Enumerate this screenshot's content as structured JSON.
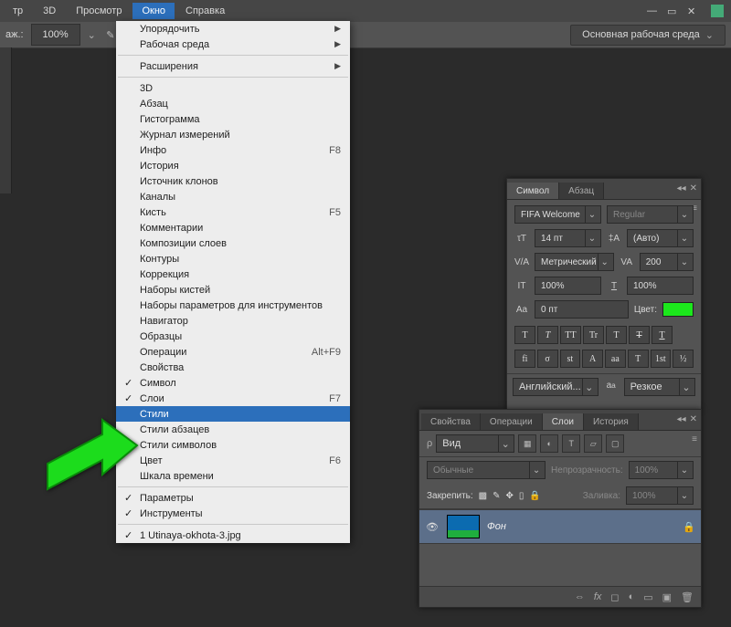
{
  "menubar": {
    "items": [
      "тр",
      "3D",
      "Просмотр",
      "Окно",
      "Справка"
    ],
    "open_index": 3
  },
  "optionsbar": {
    "zoom_label": "аж.:",
    "zoom_value": "100%",
    "workspace_label": "Основная рабочая среда"
  },
  "dropdown": {
    "groups": [
      [
        {
          "label": "Упорядочить",
          "submenu": true
        },
        {
          "label": "Рабочая среда",
          "submenu": true
        }
      ],
      [
        {
          "label": "Расширения",
          "submenu": true
        }
      ],
      [
        {
          "label": "3D"
        },
        {
          "label": "Абзац"
        },
        {
          "label": "Гистограмма"
        },
        {
          "label": "Журнал измерений"
        },
        {
          "label": "Инфо",
          "shortcut": "F8"
        },
        {
          "label": "История"
        },
        {
          "label": "Источник клонов"
        },
        {
          "label": "Каналы"
        },
        {
          "label": "Кисть",
          "shortcut": "F5"
        },
        {
          "label": "Комментарии"
        },
        {
          "label": "Композиции слоев"
        },
        {
          "label": "Контуры"
        },
        {
          "label": "Коррекция"
        },
        {
          "label": "Наборы кистей"
        },
        {
          "label": "Наборы параметров для инструментов"
        },
        {
          "label": "Навигатор"
        },
        {
          "label": "Образцы"
        },
        {
          "label": "Операции",
          "shortcut": "Alt+F9"
        },
        {
          "label": "Свойства"
        },
        {
          "label": "Символ",
          "checked": true
        },
        {
          "label": "Слои",
          "checked": true,
          "shortcut": "F7"
        },
        {
          "label": "Стили",
          "hi": true
        },
        {
          "label": "Стили абзацев"
        },
        {
          "label": "Стили символов"
        },
        {
          "label": "Цвет",
          "shortcut": "F6"
        },
        {
          "label": "Шкала времени"
        }
      ],
      [
        {
          "label": "Параметры",
          "checked": true
        },
        {
          "label": "Инструменты",
          "checked": true
        }
      ],
      [
        {
          "label": "1 Utinaya-okhota-3.jpg",
          "checked": true
        }
      ]
    ]
  },
  "charPanel": {
    "tabs": [
      "Символ",
      "Абзац"
    ],
    "active_tab": 0,
    "font": "FIFA Welcome",
    "style": "Regular",
    "size": "14 пт",
    "leading": "(Авто)",
    "kerning": "Метрический",
    "tracking": "200",
    "vscale": "100%",
    "hscale": "100%",
    "baseline": "0 пт",
    "color_label": "Цвет:",
    "color": "#1CE81C",
    "rowA": [
      "T",
      "T",
      "TT",
      "Tr",
      "T",
      "T",
      "T"
    ],
    "rowB": [
      "fi",
      "σ",
      "st",
      "A",
      "aa",
      "T",
      "1st",
      "½"
    ],
    "lang": "Английский...",
    "aa": "Резкое"
  },
  "layersPanel": {
    "tabs": [
      "Свойства",
      "Операции",
      "Слои",
      "История"
    ],
    "active_tab": 2,
    "kind_label": "Вид",
    "blend": "Обычные",
    "opacity_label": "Непрозрачность:",
    "opacity": "100%",
    "lock_label": "Закрепить:",
    "fill_label": "Заливка:",
    "fill": "100%",
    "layer_name": "Фон"
  }
}
